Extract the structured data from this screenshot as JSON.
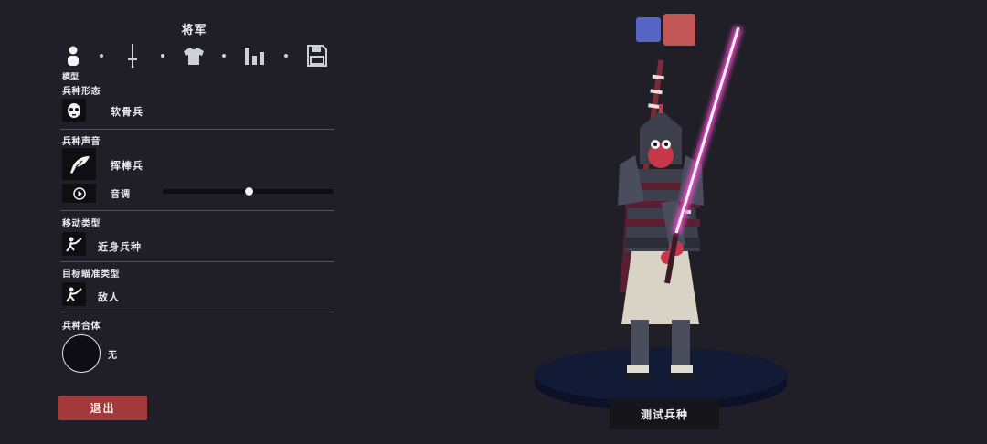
{
  "header": {
    "title": "将军"
  },
  "tabs": [
    {
      "name": "model",
      "icon": "person-icon",
      "label": "模型",
      "selected": true
    },
    {
      "name": "weapon",
      "icon": "sword-icon"
    },
    {
      "name": "clothing",
      "icon": "shirt-icon"
    },
    {
      "name": "stats",
      "icon": "bar-chart-icon"
    },
    {
      "name": "save",
      "icon": "floppy-disk-icon"
    }
  ],
  "sections": {
    "base": {
      "label": "兵种形态",
      "value": "软骨兵",
      "icon": "mask-face-icon"
    },
    "voice": {
      "label": "兵种声音",
      "value": "挥棒兵",
      "icon": "feather-icon",
      "play_icon": "play-icon",
      "pitch_label": "音调",
      "pitch": 0.5
    },
    "movement": {
      "label": "移动类型",
      "value": "近身兵种",
      "icon": "melee-unit-icon"
    },
    "targeting": {
      "label": "目标瞄准类型",
      "value": "敌人",
      "icon": "target-unit-icon"
    },
    "combine": {
      "label": "兵种合体",
      "value": "无"
    }
  },
  "buttons": {
    "exit": "退出",
    "test": "测试兵种"
  },
  "team_colors": {
    "blue": "#5566c4",
    "red": "#c25556"
  },
  "colors": {
    "background": "#201f27",
    "exit": "#a33939",
    "pedestal": "#131a35"
  }
}
